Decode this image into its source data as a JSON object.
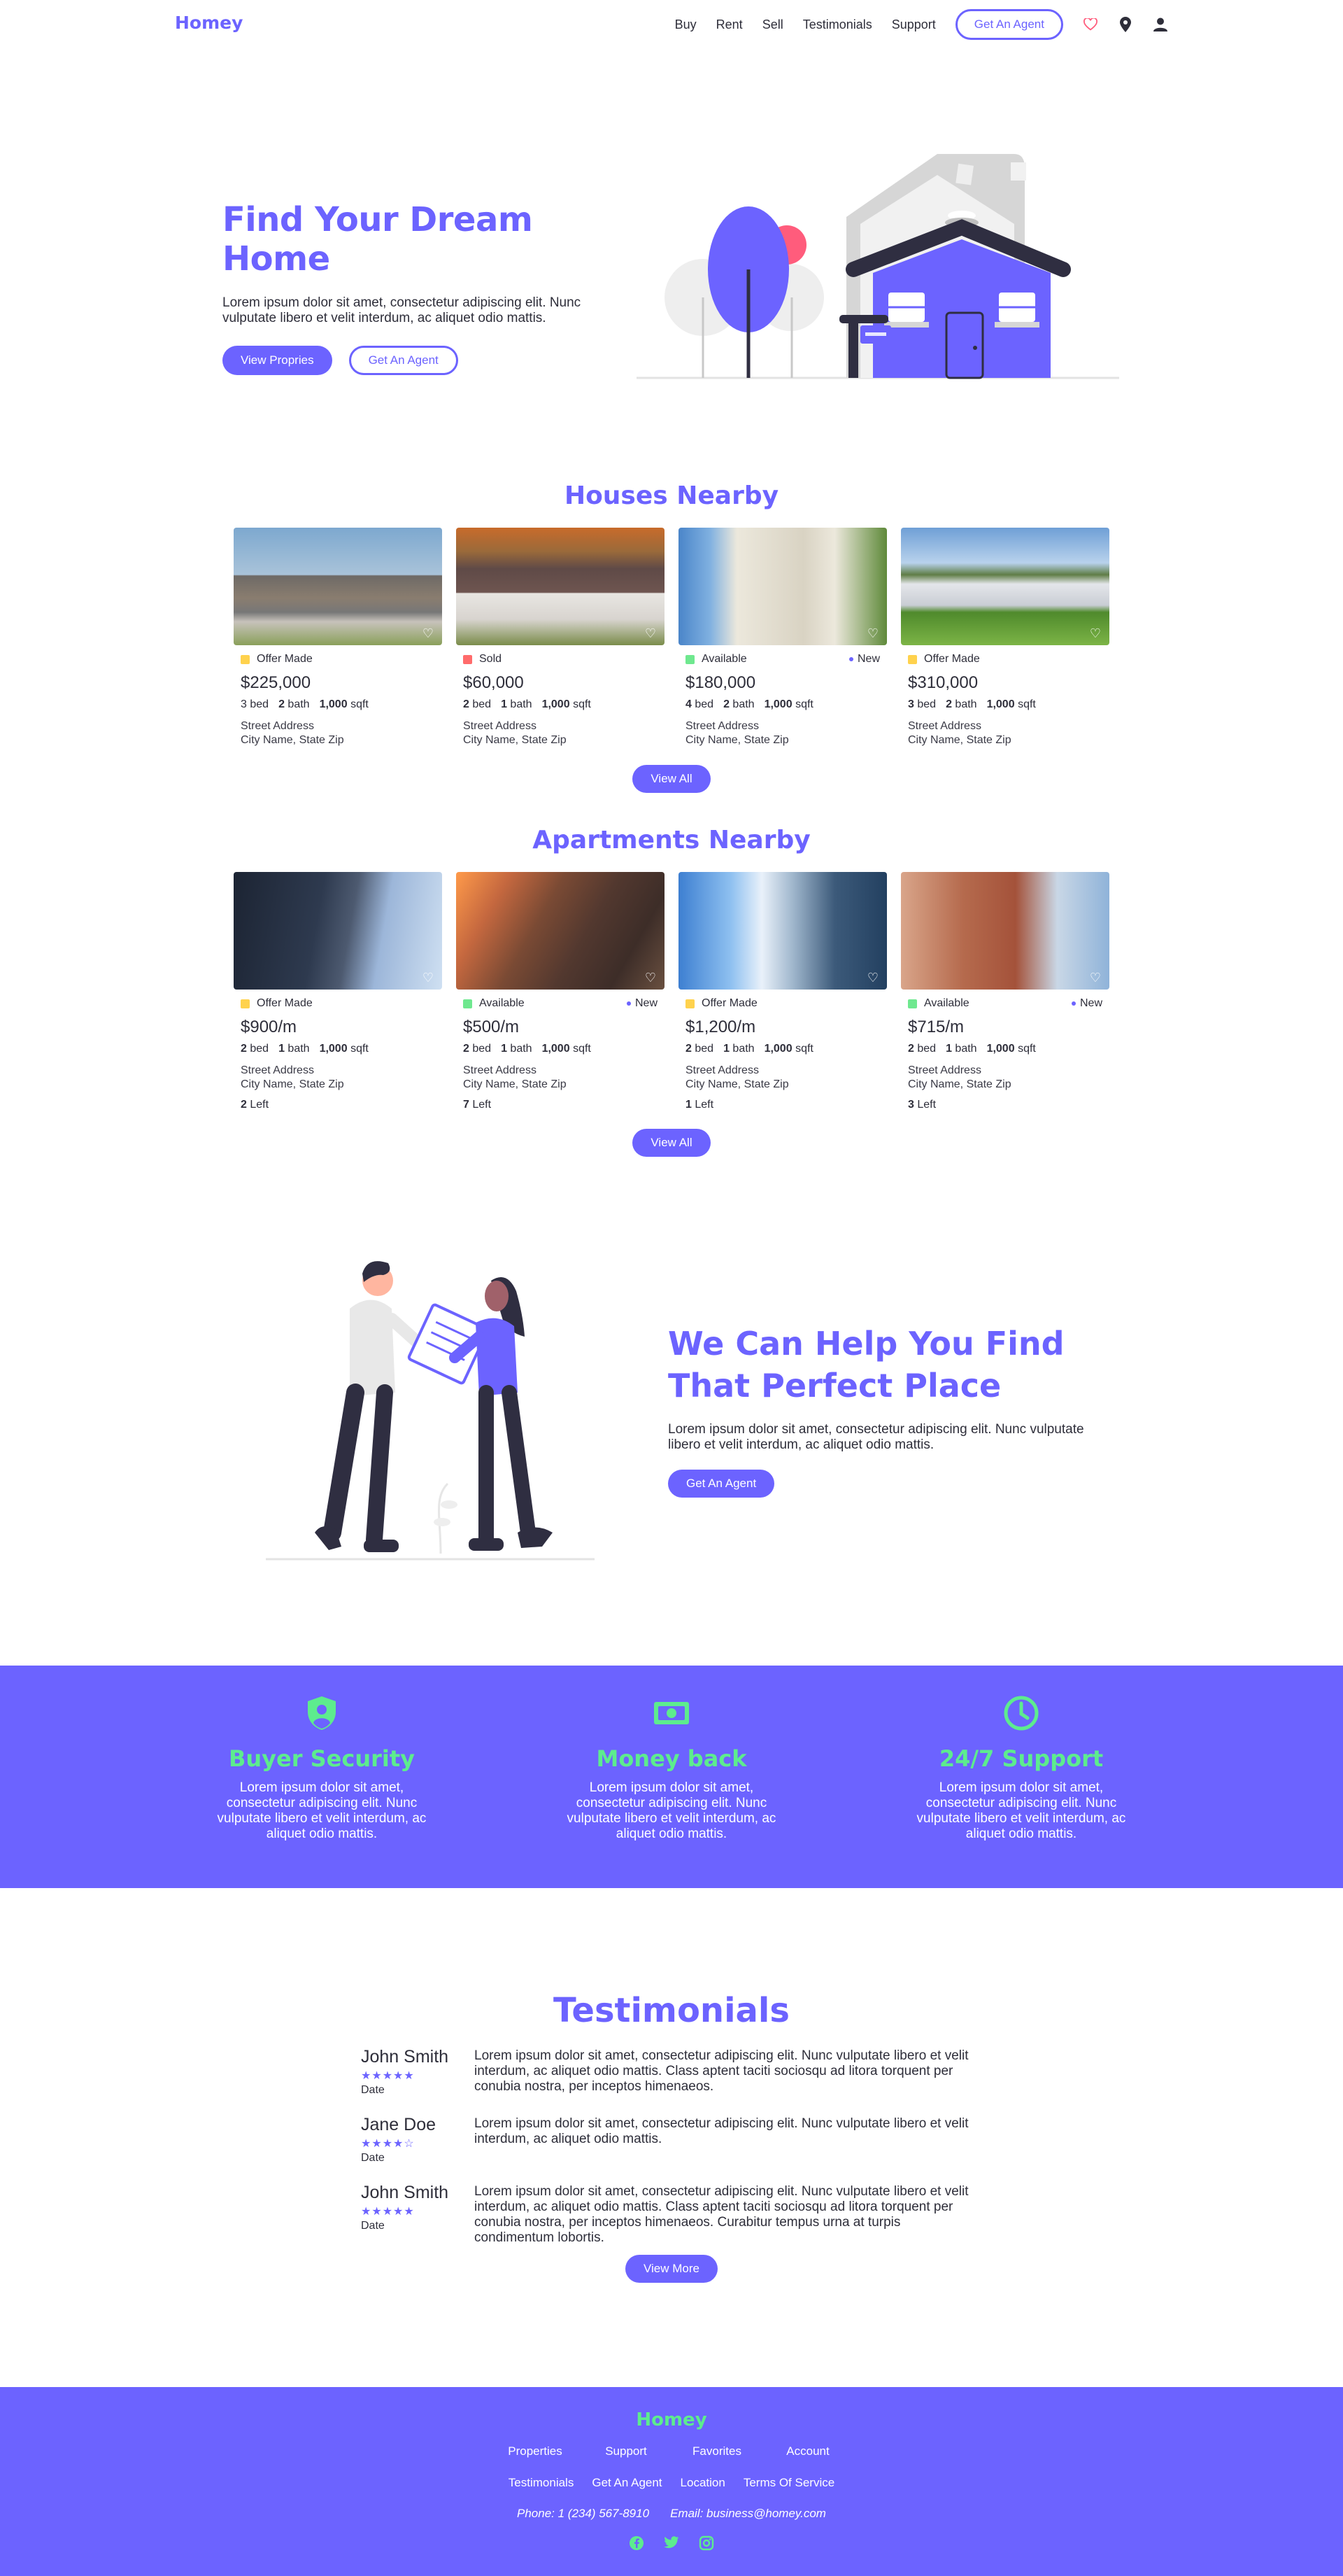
{
  "brand": {
    "name": "Homey",
    "accent": "#6c63ff",
    "green": "#5dec8e"
  },
  "nav": {
    "links": [
      "Buy",
      "Rent",
      "Sell",
      "Testimonials",
      "Support"
    ],
    "cta": "Get An Agent",
    "icons": [
      "heart-icon",
      "location-pin-icon",
      "user-icon"
    ]
  },
  "hero": {
    "title": "Find Your Dream Home",
    "subtitle": "Lorem ipsum dolor sit amet, consectetur adipiscing elit. Nunc vulputate libero et velit interdum, ac aliquet odio mattis.",
    "primary_button": "View Propries",
    "secondary_button": "Get An Agent"
  },
  "houses": {
    "title": "Houses Nearby",
    "view_all": "View All",
    "items": [
      {
        "status": "Offer Made",
        "status_color": "#ffd24d",
        "new": "",
        "price": "$225,000",
        "bed": "3",
        "bed_l": "bed",
        "bath": "2",
        "bath_l": "bath",
        "sqft": "1,000",
        "sqft_l": "sqft",
        "street": "Street Address",
        "city": "City Name, State Zip"
      },
      {
        "status": "Sold",
        "status_color": "#ff6b6b",
        "new": "",
        "price": "$60,000",
        "bed": "2",
        "bed_l": "bed",
        "bath": "1",
        "bath_l": "bath",
        "sqft": "1,000",
        "sqft_l": "sqft",
        "street": "Street Address",
        "city": "City Name, State Zip"
      },
      {
        "status": "Available",
        "status_color": "#6fe88f",
        "new": "New",
        "price": "$180,000",
        "bed": "4",
        "bed_l": "bed",
        "bath": "2",
        "bath_l": "bath",
        "sqft": "1,000",
        "sqft_l": "sqft",
        "street": "Street Address",
        "city": "City Name, State Zip"
      },
      {
        "status": "Offer Made",
        "status_color": "#ffd24d",
        "new": "",
        "price": "$310,000",
        "bed": "3",
        "bed_l": "bed",
        "bath": "2",
        "bath_l": "bath",
        "sqft": "1,000",
        "sqft_l": "sqft",
        "street": "Street Address",
        "city": "City Name, State Zip"
      }
    ]
  },
  "apartments": {
    "title": "Apartments Nearby",
    "view_all": "View All",
    "items": [
      {
        "status": "Offer Made",
        "status_color": "#ffd24d",
        "new": "",
        "price": "$900/m",
        "bed": "2",
        "bed_l": "bed",
        "bath": "1",
        "bath_l": "bath",
        "sqft": "1,000",
        "sqft_l": "sqft",
        "street": "Street Address",
        "city": "City Name, State Zip",
        "left": "2",
        "left_l": "Left"
      },
      {
        "status": "Available",
        "status_color": "#6fe88f",
        "new": "New",
        "price": "$500/m",
        "bed": "2",
        "bed_l": "bed",
        "bath": "1",
        "bath_l": "bath",
        "sqft": "1,000",
        "sqft_l": "sqft",
        "street": "Street Address",
        "city": "City Name, State Zip",
        "left": "7",
        "left_l": "Left"
      },
      {
        "status": "Offer Made",
        "status_color": "#ffd24d",
        "new": "",
        "price": "$1,200/m",
        "bed": "2",
        "bed_l": "bed",
        "bath": "1",
        "bath_l": "bath",
        "sqft": "1,000",
        "sqft_l": "sqft",
        "street": "Street Address",
        "city": "City Name, State Zip",
        "left": "1",
        "left_l": "Left"
      },
      {
        "status": "Available",
        "status_color": "#6fe88f",
        "new": "New",
        "price": "$715/m",
        "bed": "2",
        "bed_l": "bed",
        "bath": "1",
        "bath_l": "bath",
        "sqft": "1,000",
        "sqft_l": "sqft",
        "street": "Street Address",
        "city": "City Name, State Zip",
        "left": "3",
        "left_l": "Left"
      }
    ]
  },
  "help": {
    "title_line1": "We Can Help You Find",
    "title_line2": "That Perfect Place",
    "subtitle": "Lorem ipsum dolor sit amet, consectetur adipiscing elit. Nunc vulputate libero et velit interdum, ac aliquet odio mattis.",
    "button": "Get An Agent"
  },
  "features": [
    {
      "icon": "shield-user-icon",
      "title": "Buyer Security",
      "text": "Lorem ipsum dolor sit amet, consectetur adipiscing elit. Nunc vulputate libero et velit interdum, ac aliquet odio mattis."
    },
    {
      "icon": "money-icon",
      "title": "Money back",
      "text": "Lorem ipsum dolor sit amet, consectetur adipiscing elit. Nunc vulputate libero et velit interdum, ac aliquet odio mattis."
    },
    {
      "icon": "clock-icon",
      "title": "24/7 Support",
      "text": "Lorem ipsum dolor sit amet, consectetur adipiscing elit. Nunc vulputate libero et velit interdum, ac aliquet odio mattis."
    }
  ],
  "testimonials": {
    "title": "Testimonials",
    "button": "View More",
    "items": [
      {
        "name": "John Smith",
        "stars": "★★★★★",
        "rating": 5,
        "date": "Date",
        "text": "Lorem ipsum dolor sit amet, consectetur adipiscing elit. Nunc vulputate libero et velit interdum, ac aliquet odio mattis. Class aptent taciti sociosqu ad litora torquent per conubia nostra, per inceptos himenaeos."
      },
      {
        "name": "Jane Doe",
        "stars": "★★★★☆",
        "rating": 4,
        "date": "Date",
        "text": "Lorem ipsum dolor sit amet, consectetur adipiscing elit. Nunc vulputate libero et velit interdum, ac aliquet odio mattis."
      },
      {
        "name": "John Smith",
        "stars": "★★★★★",
        "rating": 5,
        "date": "Date",
        "text": "Lorem ipsum dolor sit amet, consectetur adipiscing elit. Nunc vulputate libero et velit interdum, ac aliquet odio mattis. Class aptent taciti sociosqu ad litora torquent per conubia nostra, per inceptos himenaeos. Curabitur tempus urna at turpis condimentum lobortis."
      }
    ]
  },
  "footer": {
    "logo": "Homey",
    "row1": [
      "Properties",
      "Support",
      "Favorites",
      "Account"
    ],
    "row2": [
      "Testimonials",
      "Get An Agent",
      "Location",
      "Terms Of Service"
    ],
    "phone": "Phone: 1 (234) 567-8910",
    "email": "Email: business@homey.com",
    "social": [
      "facebook-icon",
      "twitter-icon",
      "instagram-icon"
    ]
  }
}
